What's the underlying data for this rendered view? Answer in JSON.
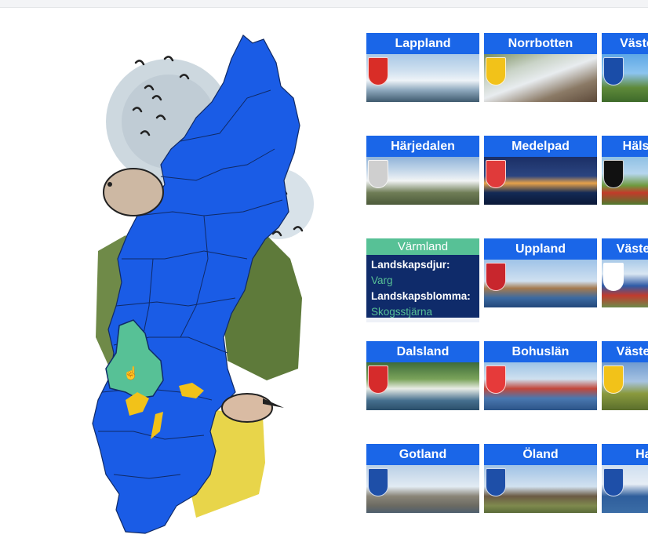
{
  "provinces": [
    {
      "name": "Lappland",
      "photo": "linear-gradient(180deg,#a9c8e6 0%,#cfe0ef 35%,#eef3f8 55%,#8fa9be 75%,#3f5a6e 100%)",
      "shield": "#d92d27"
    },
    {
      "name": "Norrbotten",
      "photo": "linear-gradient(160deg,#7b8f5e 0%,#c9d3c7 30%,#e8ecef 50%,#8b7a66 75%,#5d4a3a 100%)",
      "shield": "#f2c219"
    },
    {
      "name": "Västerbotten",
      "photo": "linear-gradient(180deg,#5da7e6 0%,#8cc4ef 40%,#5f8a3a 70%,#3e6a2a 100%)",
      "shield": "#1a4da8"
    },
    {
      "name": "Härjedalen",
      "photo": "linear-gradient(180deg,#8fb3d9 0%,#c7d9ea 30%,#f2f4f5 50%,#6f7d56 75%,#4c5a3a 100%)",
      "shield": "#cfcfcf"
    },
    {
      "name": "Medelpad",
      "photo": "linear-gradient(180deg,#1b2f66 0%,#2b4580 40%,#e6a24a 55%,#132a55 75%,#0b1838 100%)",
      "shield": "#e03a3a"
    },
    {
      "name": "Hälsingland",
      "photo": "linear-gradient(180deg,#8fc0e4 0%,#b6d6ee 35%,#6f9a3e 60%,#c23a2a 75%,#4f7a2e 100%)",
      "shield": "#111111"
    },
    {
      "name": "Värmland",
      "hover": true,
      "animal_label": "Landskapsdjur:",
      "animal": "Varg",
      "flower_label": "Landskapsblomma:",
      "flower": "Skogsstjärna"
    },
    {
      "name": "Uppland",
      "photo": "linear-gradient(180deg,#9fc3e8 0%,#cfe0f0 45%,#a57a4e 60%,#3c6aa1 80%,#22477a 100%)",
      "shield": "#c8262d"
    },
    {
      "name": "Västergötland",
      "photo": "linear-gradient(180deg,#a8c9e8 0%,#d9e6f2 30%,#2e5aa6 55%,#c13b2e 75%,#6d8a4a 100%)",
      "shield": "#ffffff"
    },
    {
      "name": "Dalsland",
      "photo": "linear-gradient(180deg,#3e6b3a 0%,#7aa35a 35%,#e8ece6 55%,#456f8e 80%,#2b4e6a 100%)",
      "shield": "#d62b2b"
    },
    {
      "name": "Bohuslän",
      "photo": "linear-gradient(180deg,#9cc3e6 0%,#cfe0ef 35%,#c2473a 55%,#4a78b0 75%,#2c5488 100%)",
      "shield": "#e63a3a"
    },
    {
      "name": "Västergötland",
      "photo": "linear-gradient(180deg,#6f9ad0 0%,#a7c3e2 40%,#8a9a3e 65%,#5a6e2c 100%)",
      "shield": "#f2c219"
    },
    {
      "name": "Gotland",
      "photo": "linear-gradient(180deg,#b9cfe6 0%,#e2ebf3 45%,#8a8578 65%,#6b6a62 85%,#4e5f6e 100%)",
      "shield": "#1e4fa8"
    },
    {
      "name": "Öland",
      "photo": "linear-gradient(180deg,#9fc2e6 0%,#d2e1ef 45%,#6b5a44 65%,#7f8a4e 85%,#5a6a38 100%)",
      "shield": "#1e4fa8"
    },
    {
      "name": "Halland",
      "photo": "linear-gradient(180deg,#cfdff0 0%,#e6edf5 40%,#2f5e9c 65%,#3b6da6 100%)",
      "shield": "#1e4fa8"
    }
  ],
  "colors": {
    "card_title": "#1a66e8",
    "hover_title": "#57c196",
    "hover_panel": "#0f2b6a",
    "map_fill": "#1a5ce6",
    "map_highlight": "#57c196"
  }
}
